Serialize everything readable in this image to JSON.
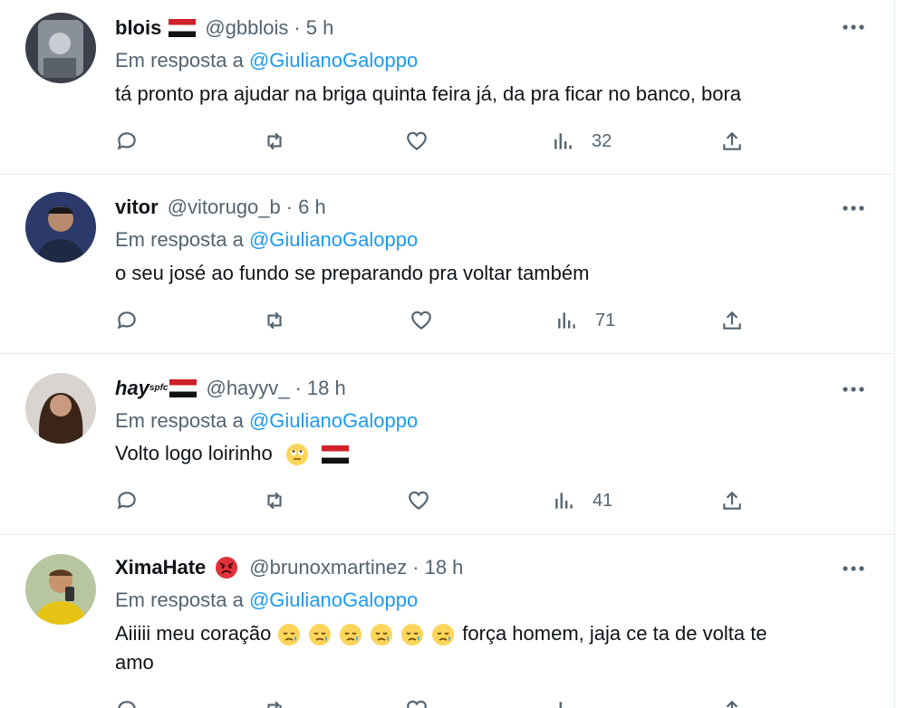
{
  "tweets": [
    {
      "name": "blois",
      "handle": "@gbblois",
      "dot": "·",
      "time": "5 h",
      "reply_prefix": "Em resposta a",
      "reply_to": "@GiulianoGaloppo",
      "text": "tá pronto pra ajudar na briga quinta feira já, da pra ficar no banco, bora",
      "views": "32"
    },
    {
      "name": "vitor",
      "handle": "@vitorugo_b",
      "dot": "·",
      "time": "6 h",
      "reply_prefix": "Em resposta a",
      "reply_to": "@GiulianoGaloppo",
      "text": "o seu josé ao fundo se preparando pra voltar também",
      "views": "71"
    },
    {
      "name": "hay",
      "name_sup": "spfc",
      "handle": "@hayyv_",
      "dot": "·",
      "time": "18 h",
      "reply_prefix": "Em resposta a",
      "reply_to": "@GiulianoGaloppo",
      "text": "Volto logo loirinho",
      "views": "41"
    },
    {
      "name": "XimaHate",
      "handle": "@brunoxmartinez",
      "dot": "·",
      "time": "18 h",
      "reply_prefix": "Em resposta a",
      "reply_to": "@GiulianoGaloppo",
      "text_before": "Aiiiii meu coração",
      "text_after": "força homem, jaja ce ta de volta te",
      "text_line2": "amo"
    }
  ],
  "colors": {
    "link": "#1d9bf0",
    "muted": "#536471",
    "text": "#0f1419",
    "divider": "#e6ecf0"
  },
  "icons": [
    "reply-icon",
    "retweet-icon",
    "like-icon",
    "views-icon",
    "share-icon",
    "more-icon",
    "flag-icon",
    "emoji"
  ]
}
